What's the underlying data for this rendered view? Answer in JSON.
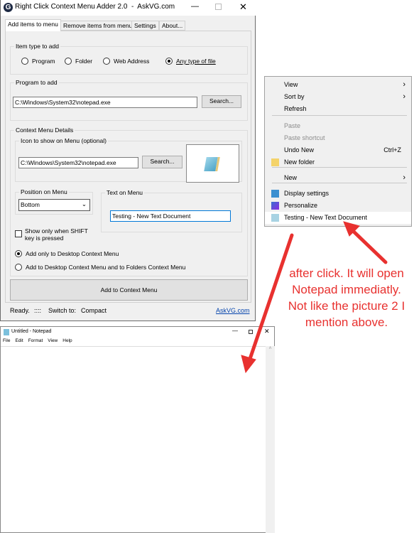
{
  "app": {
    "title": "Right Click Context Menu Adder 2.0  -  AskVG.com",
    "tabs": [
      "Add items to menu",
      "Remove items from menu",
      "Settings",
      "About..."
    ],
    "item_type": {
      "label": "Item type to add",
      "options": [
        "Program",
        "Folder",
        "Web Address",
        "Any type of file"
      ],
      "selected": "Any type of file"
    },
    "program": {
      "label": "Program to add",
      "value": "C:\\Windows\\System32\\notepad.exe",
      "search": "Search..."
    },
    "details": {
      "label": "Context Menu Details",
      "icon_label": "Icon to show on Menu (optional)",
      "icon_value": "C:\\Windows\\System32\\notepad.exe",
      "icon_search": "Search...",
      "position_label": "Position on Menu",
      "position_value": "Bottom",
      "text_label": "Text on Menu",
      "text_value": "Testing - New Text Document",
      "shift_check": "Show only when SHIFT key is pressed",
      "shift_checked": false,
      "scope_options": [
        "Add only to Desktop Context Menu",
        "Add to Desktop Context Menu and to Folders Context Menu"
      ],
      "scope_selected": "Add only to Desktop Context Menu"
    },
    "add_button": "Add to Context Menu",
    "status": {
      "ready": "Ready.",
      "grip": "::::",
      "switch_label": "Switch to:",
      "switch_value": "Compact",
      "link": "AskVG.com"
    }
  },
  "context_menu": {
    "items": [
      {
        "label": "View",
        "submenu": true
      },
      {
        "label": "Sort by",
        "submenu": true
      },
      {
        "label": "Refresh"
      },
      {
        "label": "Paste",
        "disabled": true
      },
      {
        "label": "Paste shortcut",
        "disabled": true
      },
      {
        "label": "Undo New",
        "shortcut": "Ctrl+Z"
      },
      {
        "label": "New folder",
        "icon": "folder-icon"
      },
      {
        "label": "New",
        "submenu": true
      },
      {
        "label": "Display settings",
        "icon": "display-icon"
      },
      {
        "label": "Personalize",
        "icon": "personalize-icon"
      },
      {
        "label": "Testing - New Text Document",
        "icon": "notepad-icon",
        "highlighted": true
      }
    ]
  },
  "notepad": {
    "title": "Untitled - Notepad",
    "menu": [
      "File",
      "Edit",
      "Format",
      "View",
      "Help"
    ]
  },
  "annotation": {
    "text": "after click. It will open Notepad immediatly. Not like the picture 2 I mention above.",
    "color": "#e8312f"
  }
}
